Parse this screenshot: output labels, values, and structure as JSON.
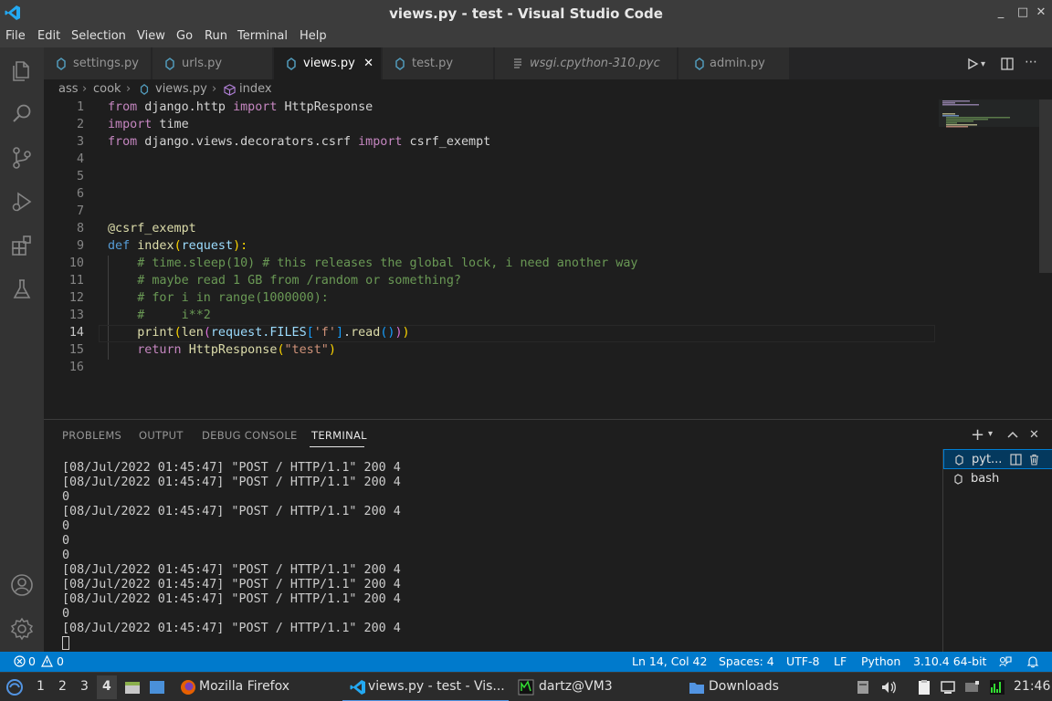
{
  "window": {
    "title": "views.py - test - Visual Studio Code",
    "controls": [
      "_",
      "□",
      "✕"
    ]
  },
  "menu": [
    "File",
    "Edit",
    "Selection",
    "View",
    "Go",
    "Run",
    "Terminal",
    "Help"
  ],
  "tabs": [
    {
      "label": "settings.py"
    },
    {
      "label": "urls.py"
    },
    {
      "label": "views.py",
      "active": true
    },
    {
      "label": "test.py"
    },
    {
      "label": "wsgi.cpython-310.pyc"
    },
    {
      "label": "admin.py"
    }
  ],
  "breadcrumb": [
    "ass",
    "cook",
    "views.py",
    "index"
  ],
  "editor": {
    "line_numbers": [
      "1",
      "2",
      "3",
      "4",
      "5",
      "6",
      "7",
      "8",
      "9",
      "10",
      "11",
      "12",
      "13",
      "14",
      "15",
      "16"
    ],
    "current_line": 14,
    "tokens": {
      "l1": [
        "from",
        " django.http ",
        "import",
        " HttpResponse"
      ],
      "l2": [
        "import",
        " time"
      ],
      "l3": [
        "from",
        " django.views.decorators.csrf ",
        "import",
        " csrf_exempt"
      ],
      "l8": [
        "@csrf_exempt"
      ],
      "l9": [
        "def",
        " ",
        "index",
        "(",
        "request",
        "):"
      ],
      "l10": [
        "    ",
        "# time.sleep(10) # this releases the global lock, i need another way"
      ],
      "l11": [
        "    ",
        "# maybe read 1 GB from /random or something?"
      ],
      "l12": [
        "    ",
        "# for i in range(1000000):"
      ],
      "l13": [
        "    ",
        "#     i**2"
      ],
      "l14": [
        "    ",
        "print",
        "(",
        "len",
        "(",
        "request.FILES",
        "[",
        "'f'",
        "]",
        ".",
        "read",
        "()",
        ")",
        ")"
      ],
      "l15": [
        "    ",
        "return",
        " ",
        "HttpResponse",
        "(",
        "\"test\"",
        ")"
      ]
    }
  },
  "panel": {
    "tabs": [
      "PROBLEMS",
      "OUTPUT",
      "DEBUG CONSOLE",
      "TERMINAL"
    ],
    "active_tab": "TERMINAL",
    "terminal_lines": [
      "[08/Jul/2022 01:45:47] \"POST / HTTP/1.1\" 200 4",
      "[08/Jul/2022 01:45:47] \"POST / HTTP/1.1\" 200 4",
      "0",
      "[08/Jul/2022 01:45:47] \"POST / HTTP/1.1\" 200 4",
      "0",
      "0",
      "0",
      "[08/Jul/2022 01:45:47] \"POST / HTTP/1.1\" 200 4",
      "[08/Jul/2022 01:45:47] \"POST / HTTP/1.1\" 200 4",
      "[08/Jul/2022 01:45:47] \"POST / HTTP/1.1\" 200 4",
      "0",
      "[08/Jul/2022 01:45:47] \"POST / HTTP/1.1\" 200 4"
    ],
    "terminals": [
      "pyt...",
      "bash"
    ]
  },
  "status": {
    "errors": "0",
    "warnings": "0",
    "position": "Ln 14, Col 42",
    "spaces": "Spaces: 4",
    "encoding": "UTF-8",
    "eol": "LF",
    "language": "Python",
    "interpreter": "3.10.4 64-bit"
  },
  "taskbar": {
    "workspaces": [
      "1",
      "2",
      "3",
      "4"
    ],
    "active_workspace": "4",
    "apps": [
      "Mozilla Firefox",
      "views.py - test - Vis...",
      "dartz@VM3",
      "Downloads"
    ],
    "clock": "21:46"
  },
  "colors": {
    "accent": "#007acc",
    "titlebar": "#3c3c3c",
    "editor_bg": "#1e1e1e"
  }
}
